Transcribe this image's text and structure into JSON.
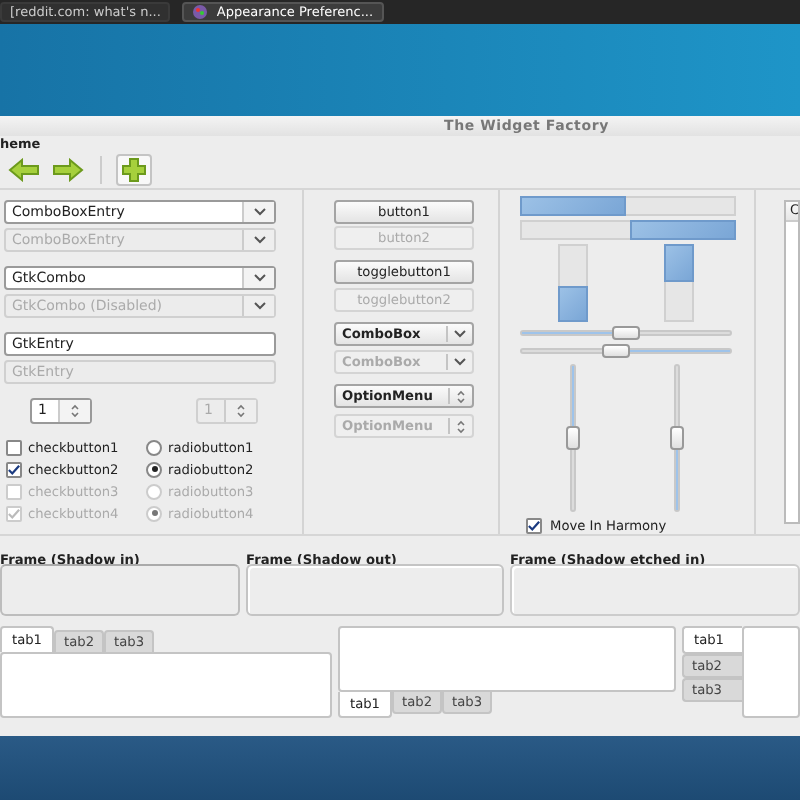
{
  "taskbar": {
    "tasks": [
      {
        "label": "[reddit.com: what's n...",
        "selected": false
      },
      {
        "label": "Appearance Preferenc...",
        "selected": true
      }
    ]
  },
  "window": {
    "title": "The Widget Factory"
  },
  "menu": [
    "heme"
  ],
  "entries": [
    {
      "kind": "comboentry",
      "value": "ComboBoxEntry",
      "disabled": false
    },
    {
      "kind": "comboentry",
      "value": "ComboBoxEntry",
      "disabled": true
    },
    {
      "kind": "combo",
      "value": "GtkCombo",
      "disabled": false
    },
    {
      "kind": "combo",
      "value": "GtkCombo (Disabled)",
      "disabled": true
    },
    {
      "kind": "entry",
      "value": "GtkEntry",
      "disabled": false
    },
    {
      "kind": "entry",
      "value": "GtkEntry",
      "disabled": true
    }
  ],
  "spins": [
    {
      "value": "1",
      "disabled": false
    },
    {
      "value": "1",
      "disabled": true
    }
  ],
  "checks": [
    {
      "label": "checkbutton1",
      "checked": false,
      "disabled": false
    },
    {
      "label": "checkbutton2",
      "checked": true,
      "disabled": false
    },
    {
      "label": "checkbutton3",
      "checked": false,
      "disabled": true
    },
    {
      "label": "checkbutton4",
      "checked": true,
      "disabled": true
    }
  ],
  "radios": [
    {
      "label": "radiobutton1",
      "selected": false,
      "disabled": false
    },
    {
      "label": "radiobutton2",
      "selected": true,
      "disabled": false
    },
    {
      "label": "radiobutton3",
      "selected": false,
      "disabled": true
    },
    {
      "label": "radiobutton4",
      "selected": true,
      "disabled": true
    }
  ],
  "buttons": [
    {
      "kind": "button",
      "label": "button1",
      "disabled": false
    },
    {
      "kind": "button",
      "label": "button2",
      "disabled": true
    },
    {
      "kind": "toggle",
      "label": "togglebutton1",
      "disabled": false
    },
    {
      "kind": "toggle",
      "label": "togglebutton2",
      "disabled": true
    },
    {
      "kind": "combo",
      "label": "ComboBox",
      "disabled": false
    },
    {
      "kind": "combo",
      "label": "ComboBox",
      "disabled": true
    },
    {
      "kind": "option",
      "label": "OptionMenu",
      "disabled": false
    },
    {
      "kind": "option",
      "label": "OptionMenu",
      "disabled": true
    }
  ],
  "progress_bars": [
    {
      "kind": "horizontal",
      "inverted": false,
      "level": 0.5
    },
    {
      "kind": "horizontal",
      "inverted": true,
      "level": 0.5
    },
    {
      "kind": "vertical",
      "inverted": false,
      "level": 0.5
    },
    {
      "kind": "vertical",
      "inverted": true,
      "level": 0.5
    }
  ],
  "hscales": [
    {
      "inverted": false,
      "level": 0.5
    },
    {
      "inverted": true,
      "level": 0.45
    }
  ],
  "vscales": [
    {
      "inverted": true,
      "level": 0.5
    },
    {
      "inverted": false,
      "level": 0.5
    }
  ],
  "harmony": {
    "label": "Move In Harmony",
    "checked": true
  },
  "list": {
    "columns": [
      "C"
    ]
  },
  "frames": [
    {
      "kind": "in",
      "label": "Frame (Shadow in)"
    },
    {
      "kind": "out",
      "label": "Frame (Shadow out)"
    },
    {
      "kind": "etched",
      "label": "Frame (Shadow etched in)"
    }
  ],
  "notebooks": [
    {
      "kind": "top",
      "tabs": [
        {
          "label": "tab1",
          "selected": true
        },
        {
          "label": "tab2",
          "selected": false
        },
        {
          "label": "tab3",
          "selected": false
        }
      ]
    },
    {
      "kind": "bottom",
      "tabs": [
        {
          "label": "tab1",
          "selected": true
        },
        {
          "label": "tab2",
          "selected": false
        },
        {
          "label": "tab3",
          "selected": false
        }
      ]
    },
    {
      "kind": "left",
      "tabs": [
        {
          "label": "tab1",
          "selected": true
        },
        {
          "label": "tab2",
          "selected": false
        },
        {
          "label": "tab3",
          "selected": false
        }
      ]
    }
  ]
}
